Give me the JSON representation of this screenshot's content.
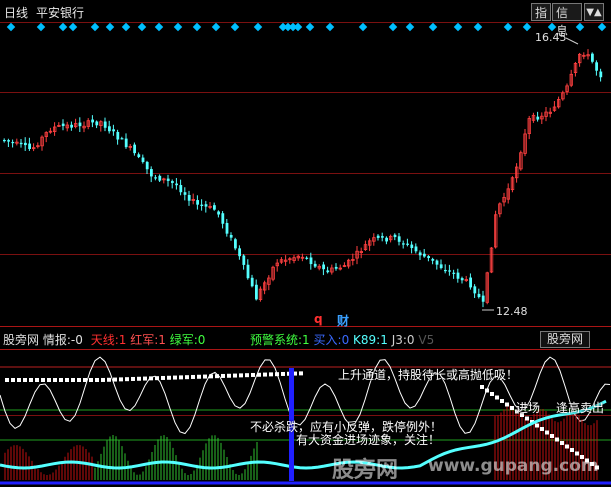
{
  "header": {
    "period": "日线",
    "stock": "平安银行",
    "btn_indicator": "指",
    "btn_info": "信息"
  },
  "price": {
    "high_label": "16.45",
    "low_label": "12.48",
    "marker_q": "q",
    "marker_cai": "财"
  },
  "indicator_bar": {
    "panel_name": "股旁网",
    "info_label": "情报:",
    "info_value": "-0",
    "tianxian_label": "天线:",
    "tianxian_value": "1",
    "hongjun_label": "红军:",
    "hongjun_value": "1",
    "lvjun_label": "绿军:",
    "lvjun_value": "0",
    "yujing_label": "预警系统:",
    "yujing_value": "1",
    "mairu_label": "买入:",
    "mairu_value": "0",
    "k89_label": "K89:",
    "k89_value": "1",
    "j3_label": "J3:",
    "j3_value": "0",
    "v5_label": "V5",
    "panel_button": "股旁网"
  },
  "messages": {
    "rise_channel": "上升通道，持股待长或高抛低吸！",
    "no_chase": "不必杀跌，应有小反弹，跌停例外！",
    "big_funds": "有大资金进场迹象，关注！",
    "enter_market": "进场",
    "scale_sell": "逢高卖出"
  },
  "watermark": {
    "cn": "股旁网",
    "url": "www.gupang.com"
  },
  "colors": {
    "bg": "#000000",
    "up": "#ff4040",
    "down": "#54ffff",
    "grid": "#7a1010",
    "diamond": "#00bfff",
    "yellow": "#ffff00",
    "green": "#00ff00",
    "blue": "#2020ff"
  }
}
